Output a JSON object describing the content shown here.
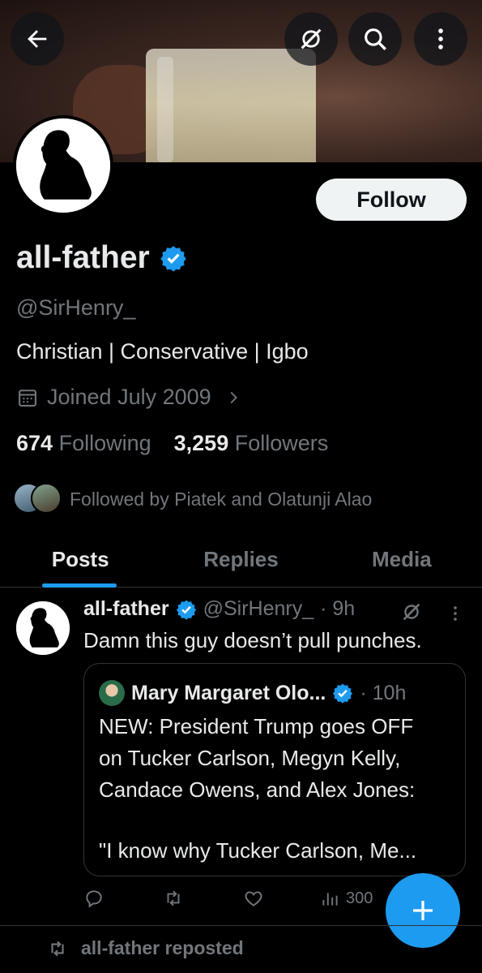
{
  "profile": {
    "name": "all-father",
    "handle": "@SirHenry_",
    "bio": "Christian | Conservative | Igbo",
    "joined": "Joined July 2009",
    "following_count": "674",
    "following_label": "Following",
    "followers_count": "3,259",
    "followers_label": "Followers",
    "followed_by": "Followed by Piatek and Olatunji Alao",
    "follow_label": "Follow"
  },
  "tabs": [
    {
      "label": "Posts",
      "active": true
    },
    {
      "label": "Replies",
      "active": false
    },
    {
      "label": "Media",
      "active": false
    }
  ],
  "post": {
    "author": "all-father",
    "handle": "@SirHenry_",
    "time": "· 9h",
    "text": "Damn this guy doesn’t pull punches.",
    "quote": {
      "author": "Mary Margaret Olo...",
      "time": "· 10h",
      "line1": "NEW: President Trump goes OFF",
      "line2": "on Tucker Carlson, Megyn Kelly,",
      "line3": "Candace Owens, and Alex Jones:",
      "line4": "\"I know why Tucker Carlson, Me..."
    },
    "views": "300"
  },
  "next_item": {
    "repost_text": "all-father reposted"
  },
  "colors": {
    "accent": "#1d9bf0",
    "background": "#000000",
    "text_primary": "#e7e9ea",
    "text_secondary": "#71767b"
  },
  "icons": [
    "back-arrow-icon",
    "grok-icon",
    "search-icon",
    "more-vertical-icon",
    "verified-badge-icon",
    "calendar-icon",
    "chevron-right-icon",
    "reply-icon",
    "repost-icon",
    "like-icon",
    "views-icon",
    "plus-icon"
  ]
}
